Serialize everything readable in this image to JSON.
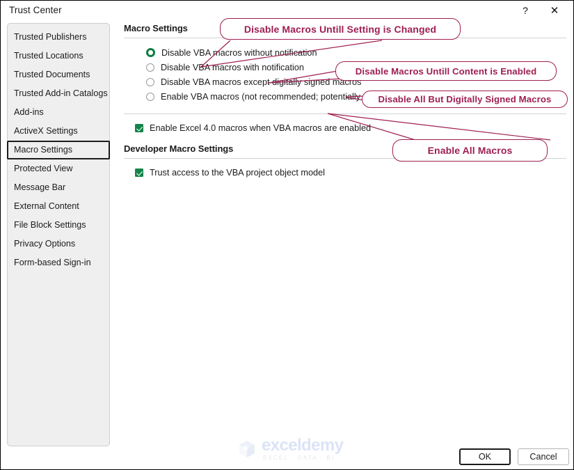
{
  "window": {
    "title": "Trust Center",
    "help_label": "?",
    "close_label": "✕"
  },
  "sidebar": {
    "items": [
      {
        "label": "Trusted Publishers",
        "selected": false
      },
      {
        "label": "Trusted Locations",
        "selected": false
      },
      {
        "label": "Trusted Documents",
        "selected": false
      },
      {
        "label": "Trusted Add-in Catalogs",
        "selected": false
      },
      {
        "label": "Add-ins",
        "selected": false
      },
      {
        "label": "ActiveX Settings",
        "selected": false
      },
      {
        "label": "Macro Settings",
        "selected": true
      },
      {
        "label": "Protected View",
        "selected": false
      },
      {
        "label": "Message Bar",
        "selected": false
      },
      {
        "label": "External Content",
        "selected": false
      },
      {
        "label": "File Block Settings",
        "selected": false
      },
      {
        "label": "Privacy Options",
        "selected": false
      },
      {
        "label": "Form-based Sign-in",
        "selected": false
      }
    ]
  },
  "main": {
    "macro_settings_header": "Macro Settings",
    "radio_options": [
      {
        "label": "Disable VBA macros without notification",
        "checked": true
      },
      {
        "label": "Disable VBA macros with notification",
        "checked": false
      },
      {
        "label": "Disable VBA macros except digitally signed macros",
        "checked": false
      },
      {
        "label": "Enable VBA macros (not recommended; potentially dangerous code can run)",
        "checked": false
      }
    ],
    "excel4_checkbox": {
      "label": "Enable Excel 4.0 macros when VBA macros are enabled",
      "checked": true
    },
    "developer_header": "Developer Macro Settings",
    "vba_trust_checkbox": {
      "label": "Trust access to the VBA project object model",
      "checked": true
    }
  },
  "callouts": [
    {
      "text": "Disable Macros Untill Setting is Changed"
    },
    {
      "text": "Disable Macros Untill Content is Enabled"
    },
    {
      "text": "Disable All But Digitally Signed Macros"
    },
    {
      "text": "Enable All Macros"
    }
  ],
  "watermark": {
    "name": "exceldemy",
    "subtitle": "EXCEL · DATA · BI"
  },
  "footer": {
    "ok_label": "OK",
    "cancel_label": "Cancel"
  },
  "colors": {
    "callout_accent": "#9e1f52",
    "radio_selected": "#107c41",
    "checkbox_fill": "#14844a",
    "sidebar_bg": "#efefef"
  }
}
